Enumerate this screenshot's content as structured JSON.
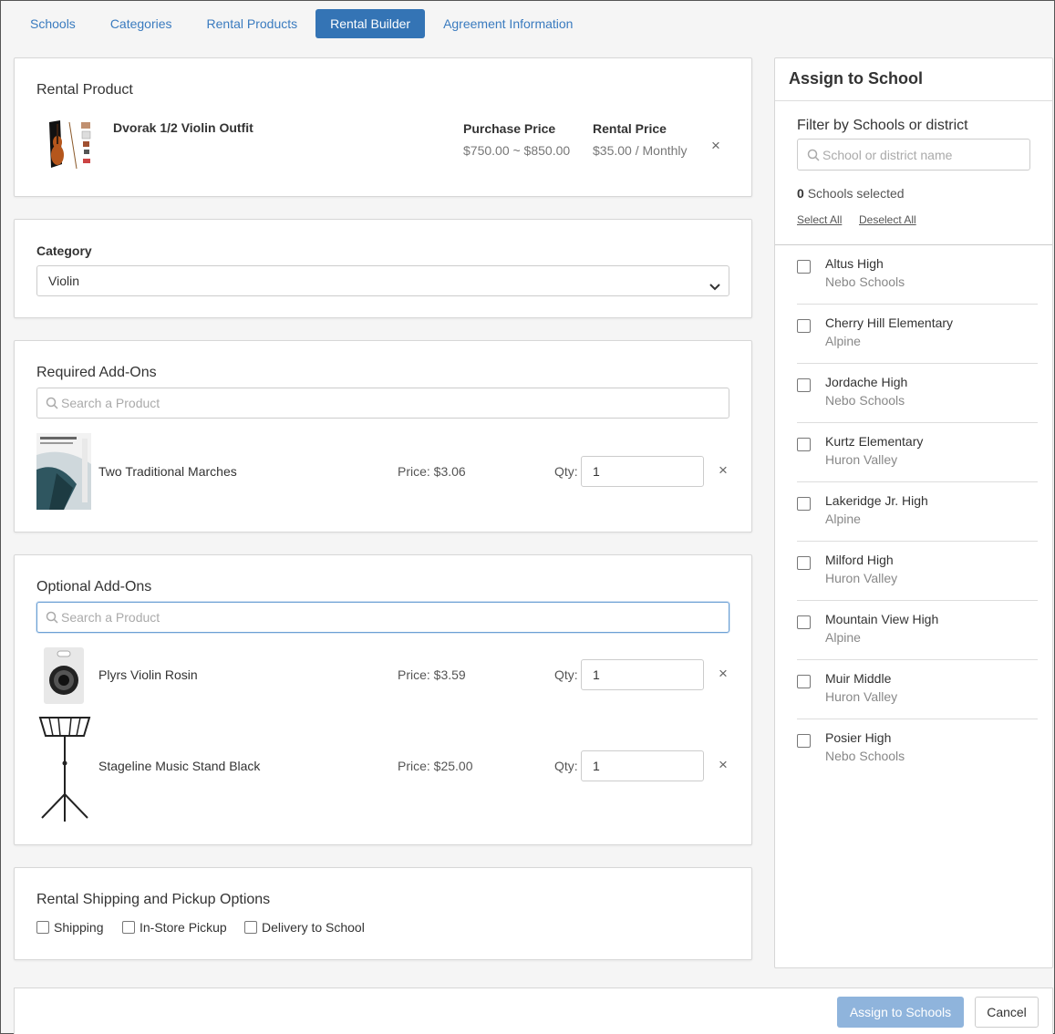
{
  "tabs": [
    {
      "label": "Schools"
    },
    {
      "label": "Categories"
    },
    {
      "label": "Rental Products"
    },
    {
      "label": "Rental Builder",
      "active": true
    },
    {
      "label": "Agreement Information"
    }
  ],
  "rental_product": {
    "section_title": "Rental Product",
    "name": "Dvorak 1/2 Violin Outfit",
    "purchase_price_label": "Purchase Price",
    "purchase_price": "$750.00 ~ $850.00",
    "rental_price_label": "Rental Price",
    "rental_price": "$35.00 / Monthly",
    "remove_icon": "×"
  },
  "category": {
    "label": "Category",
    "selected": "Violin"
  },
  "required_addons": {
    "section_title": "Required Add-Ons",
    "search_placeholder": "Search a Product",
    "items": [
      {
        "name": "Two Traditional Marches",
        "price": "Price: $3.06",
        "qty_label": "Qty:",
        "qty": "1"
      }
    ]
  },
  "optional_addons": {
    "section_title": "Optional Add-Ons",
    "search_placeholder": "Search a Product",
    "items": [
      {
        "name": "Plyrs Violin Rosin",
        "price": "Price: $3.59",
        "qty_label": "Qty:",
        "qty": "1"
      },
      {
        "name": "Stageline Music Stand Black",
        "price": "Price: $25.00",
        "qty_label": "Qty:",
        "qty": "1"
      }
    ]
  },
  "shipping": {
    "section_title": "Rental Shipping and Pickup Options",
    "options": [
      "Shipping",
      "In-Store Pickup",
      "Delivery to School"
    ]
  },
  "assign_panel": {
    "title": "Assign to School",
    "filter_label": "Filter by Schools or district",
    "search_placeholder": "School or district name",
    "selected_count": "0",
    "selected_suffix": "Schools selected",
    "select_all": "Select All",
    "deselect_all": "Deselect All",
    "schools": [
      {
        "name": "Altus High",
        "district": "Nebo Schools"
      },
      {
        "name": "Cherry Hill Elementary",
        "district": "Alpine"
      },
      {
        "name": "Jordache High",
        "district": "Nebo Schools"
      },
      {
        "name": "Kurtz Elementary",
        "district": "Huron Valley"
      },
      {
        "name": "Lakeridge Jr. High",
        "district": "Alpine"
      },
      {
        "name": "Milford High",
        "district": "Huron Valley"
      },
      {
        "name": "Mountain View High",
        "district": "Alpine"
      },
      {
        "name": "Muir Middle",
        "district": "Huron Valley"
      },
      {
        "name": "Posier High",
        "district": "Nebo Schools"
      }
    ]
  },
  "footer": {
    "assign_button": "Assign to Schools",
    "cancel_button": "Cancel"
  },
  "colors": {
    "accent": "#3474b5",
    "link": "#3a7bbf",
    "primary_disabled": "#8fb4dc"
  }
}
